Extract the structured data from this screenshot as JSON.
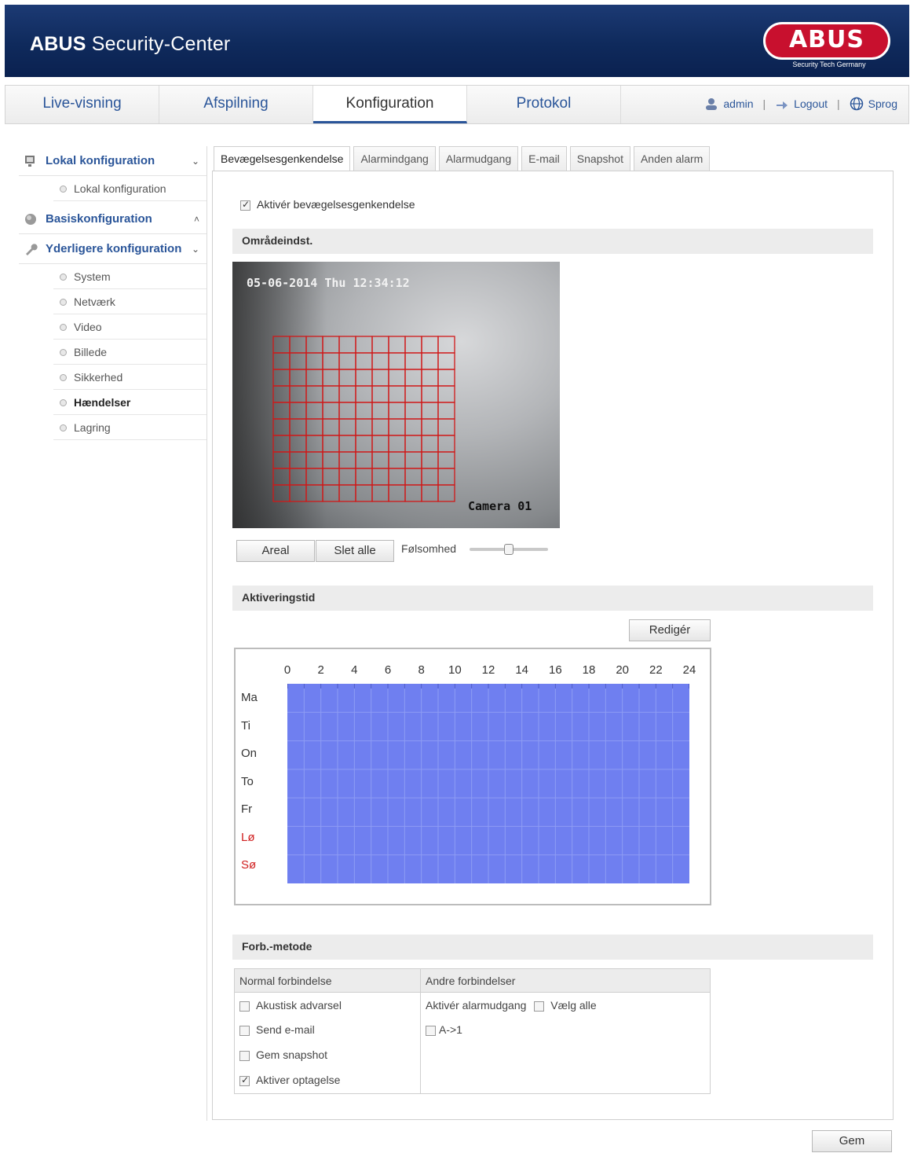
{
  "header": {
    "title_bold": "ABUS",
    "title_rest": " Security-Center",
    "logo_text": "ABUS",
    "logo_sub": "Security Tech Germany"
  },
  "nav": {
    "tabs": [
      "Live-visning",
      "Afspilning",
      "Konfiguration",
      "Protokol"
    ],
    "active_index": 2,
    "user": "admin",
    "logout": "Logout",
    "language": "Sprog"
  },
  "sidebar": {
    "sections": [
      {
        "label": "Lokal konfiguration",
        "chevron": "⌄",
        "icon": "monitor-icon",
        "items": [
          "Lokal konfiguration"
        ]
      },
      {
        "label": "Basiskonfiguration",
        "chevron": "˄",
        "icon": "globe-icon",
        "items": []
      },
      {
        "label": "Yderligere konfiguration",
        "chevron": "⌄",
        "icon": "wrench-icon",
        "items": [
          "System",
          "Netværk",
          "Video",
          "Billede",
          "Sikkerhed",
          "Hændelser",
          "Lagring"
        ],
        "active_item": "Hændelser"
      }
    ]
  },
  "tabs": {
    "items": [
      "Bevægelsesgenkendelse",
      "Alarmindgang",
      "Alarmudgang",
      "E-mail",
      "Snapshot",
      "Anden alarm"
    ],
    "active_index": 0
  },
  "motion": {
    "enable_label": "Aktivér bevægelsesgenkendelse",
    "enabled": true,
    "area_section": "Områdeindst.",
    "camera_timestamp": "05-06-2014 Thu 12:34:12",
    "camera_name": "Camera 01",
    "area_button": "Areal",
    "clear_button": "Slet alle",
    "sensitivity_label": "Følsomhed",
    "sensitivity_level": 0.5
  },
  "schedule": {
    "section": "Aktiveringstid",
    "edit_button": "Redigér",
    "hours": [
      "0",
      "2",
      "4",
      "6",
      "8",
      "10",
      "12",
      "14",
      "16",
      "18",
      "20",
      "22",
      "24"
    ],
    "days": [
      {
        "label": "Ma",
        "weekend": false
      },
      {
        "label": "Ti",
        "weekend": false
      },
      {
        "label": "On",
        "weekend": false
      },
      {
        "label": "To",
        "weekend": false
      },
      {
        "label": "Fr",
        "weekend": false
      },
      {
        "label": "Lø",
        "weekend": true
      },
      {
        "label": "Sø",
        "weekend": true
      }
    ],
    "fill_color": "#6f7ff0",
    "grid_color": "#8e9cf4"
  },
  "linkage": {
    "section": "Forb.-metode",
    "normal_header": "Normal forbindelse",
    "other_header": "Andre forbindelser",
    "normal_items": [
      {
        "label": "Akustisk advarsel",
        "checked": false
      },
      {
        "label": "Send e-mail",
        "checked": false
      },
      {
        "label": "Gem snapshot",
        "checked": false
      },
      {
        "label": "Aktiver optagelse",
        "checked": true
      }
    ],
    "trigger_label": "Aktivér alarmudgang",
    "select_all_label": "Vælg alle",
    "output_item": "A->1"
  },
  "save_button": "Gem"
}
